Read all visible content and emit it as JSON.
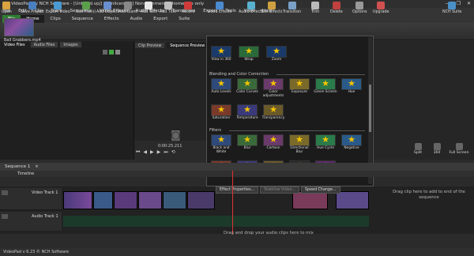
{
  "window": {
    "title": "VideoPad by NCH Software - [Untitled.vpj] - [Unlicensed] Non-commercial home use only",
    "controls": [
      "—",
      "❐",
      "✕"
    ]
  },
  "menu": [
    "File",
    "Edit",
    "Clip",
    "Track",
    "Sequence",
    "Video Effects",
    "Audio Effects",
    "Transitions",
    "Export",
    "Tools",
    "View",
    "Help"
  ],
  "tabs": [
    "File",
    "Home",
    "Clips",
    "Sequence",
    "Effects",
    "Audio",
    "Export",
    "Suite"
  ],
  "tab_active": "Home",
  "ribbon": [
    {
      "label": "Open",
      "icon": "folder-icon",
      "color": "#d9a441"
    },
    {
      "label": "Save Project",
      "icon": "save-icon",
      "color": "#4a7fc1"
    },
    {
      "label": "Export Video",
      "icon": "export-icon",
      "color": "#4a9ad4"
    },
    {
      "label": "Add File(s)",
      "icon": "add-file-icon",
      "color": "#5aa04a"
    },
    {
      "label": "Add Objects",
      "icon": "add-objects-icon",
      "color": "#6a8fd0"
    },
    {
      "label": "Add Blank",
      "icon": "add-blank-icon",
      "color": "#888"
    },
    {
      "label": "Add Text",
      "icon": "text-icon",
      "color": "#e8e8e8"
    },
    {
      "label": "Add Title",
      "icon": "title-icon",
      "color": "#c0c0c0"
    },
    {
      "label": "Record",
      "icon": "record-icon",
      "color": "#d03a3a"
    },
    {
      "label": "Video Effects",
      "icon": "video-effects-icon",
      "color": "#4a8ad0"
    },
    {
      "label": "Audio Effects",
      "icon": "audio-effects-icon",
      "color": "#5ab0d0"
    },
    {
      "label": "Text Effects",
      "icon": "text-effects-icon",
      "color": "#d0a040"
    },
    {
      "label": "Transition",
      "icon": "transition-icon",
      "color": "#7aa0c8"
    },
    {
      "label": "Trim",
      "icon": "trim-icon",
      "color": "#bbb"
    },
    {
      "label": "Delete",
      "icon": "delete-icon",
      "color": "#c04040"
    },
    {
      "label": "Options",
      "icon": "options-icon",
      "color": "#999"
    },
    {
      "label": "Upgrade",
      "icon": "upgrade-icon",
      "color": "#d05050"
    },
    {
      "label": "NCH Suite",
      "icon": "suite-icon",
      "color": "#4a90c8"
    }
  ],
  "left_panel": {
    "tabs": [
      "Video Files",
      "Audio Files",
      "Images"
    ],
    "media": {
      "name": "Ball Grabbers.mp4"
    }
  },
  "preview": {
    "tabs": [
      "Clip Preview",
      "Sequence Preview"
    ],
    "timecode": "0:00:25.211"
  },
  "effects_menu": {
    "top_items": [
      "View in 360",
      "Wrap",
      "Zoom"
    ],
    "sections": [
      {
        "title": "Blending and Color Correction",
        "items": [
          "Auto Levels",
          "Color Curves",
          "Color adjustments",
          "Exposure",
          "Green Screen",
          "Hue",
          "Saturation",
          "Temperature",
          "Transparency"
        ]
      },
      {
        "title": "Filters",
        "items": [
          "Black and White",
          "Blur",
          "Cartoon",
          "Directional Blur",
          "Hue Cycle",
          "Negative",
          "Night Vision",
          "Sepia",
          "Sharpen",
          "Two Tone",
          "X-ray"
        ]
      }
    ]
  },
  "right_buttons": [
    {
      "label": "Split"
    },
    {
      "label": "360"
    },
    {
      "label": "Full Screen"
    }
  ],
  "sequence": {
    "tab": "Sequence 1",
    "timeline_label": "Timeline"
  },
  "tracks": {
    "video": "Video Track 1",
    "audio": "Audio Track 1"
  },
  "clip_bar": [
    "Effect Properties...",
    "Stabilize Video...",
    "Speed Change..."
  ],
  "drag_video": "Drag clip here to add to end of the sequence",
  "drag_audio": "Drag and drop your audio clips here to mix",
  "status": "VideoPad v 6.23 © NCH Software"
}
